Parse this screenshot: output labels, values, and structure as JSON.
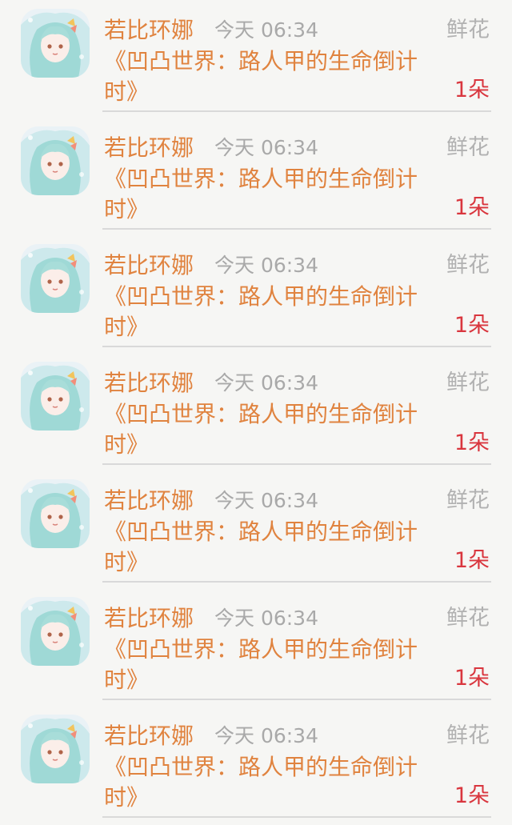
{
  "records": [
    {
      "user": "若比环娜",
      "time": "今天 06:34",
      "gift_type": "鲜花",
      "book_title": "《凹凸世界：路人甲的生命倒计时》",
      "count": "1朵"
    },
    {
      "user": "若比环娜",
      "time": "今天 06:34",
      "gift_type": "鲜花",
      "book_title": "《凹凸世界：路人甲的生命倒计时》",
      "count": "1朵"
    },
    {
      "user": "若比环娜",
      "time": "今天 06:34",
      "gift_type": "鲜花",
      "book_title": "《凹凸世界：路人甲的生命倒计时》",
      "count": "1朵"
    },
    {
      "user": "若比环娜",
      "time": "今天 06:34",
      "gift_type": "鲜花",
      "book_title": "《凹凸世界：路人甲的生命倒计时》",
      "count": "1朵"
    },
    {
      "user": "若比环娜",
      "time": "今天 06:34",
      "gift_type": "鲜花",
      "book_title": "《凹凸世界：路人甲的生命倒计时》",
      "count": "1朵"
    },
    {
      "user": "若比环娜",
      "time": "今天 06:34",
      "gift_type": "鲜花",
      "book_title": "《凹凸世界：路人甲的生命倒计时》",
      "count": "1朵"
    },
    {
      "user": "若比环娜",
      "time": "今天 06:34",
      "gift_type": "鲜花",
      "book_title": "《凹凸世界：路人甲的生命倒计时》",
      "count": "1朵"
    }
  ],
  "colors": {
    "name": "#e0833f",
    "book_title": "#e0833f",
    "time": "#a9a9a9",
    "gift_type": "#b1b1b1",
    "count": "#d9363e",
    "background": "#f6f6f4"
  }
}
